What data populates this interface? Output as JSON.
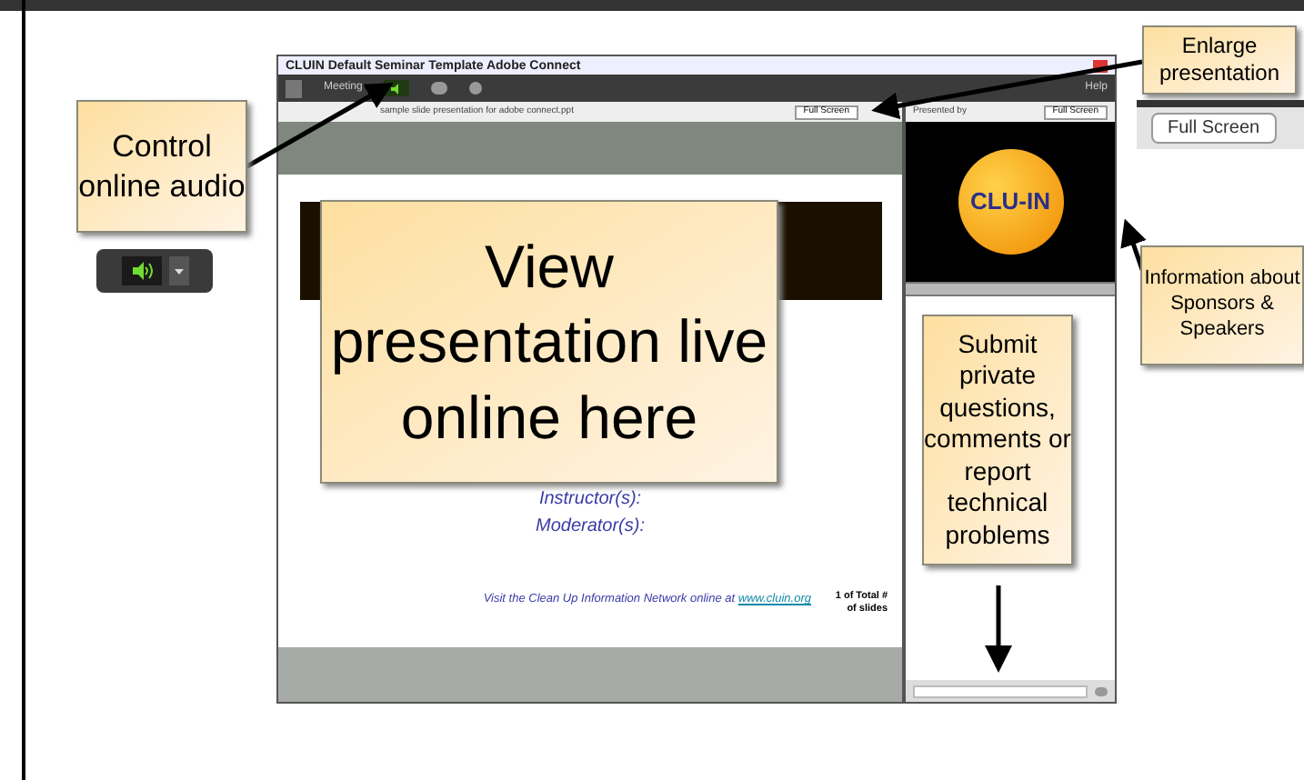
{
  "window": {
    "title": "CLUIN Default Seminar Template  Adobe Connect",
    "menu": [
      "Meeting",
      "Help"
    ]
  },
  "presentation": {
    "file_name": "sample slide presentation for adobe connect.ppt",
    "full_screen": "Full Screen",
    "instructors": "Instructor(s):",
    "moderators": "Moderator(s):",
    "footer": "Visit the Clean Up Information Network online at",
    "link": "www.cluin.org",
    "page": "1 of Total # of slides"
  },
  "sponsor_pod": {
    "title": "Presented by",
    "full_screen": "Full Screen",
    "logo": "CLU-IN"
  },
  "callouts": [
    {
      "kind": "audio",
      "text": "Control online audio"
    },
    {
      "kind": "enlarge",
      "text": "Enlarge presentation",
      "button": "Full Screen"
    },
    {
      "kind": "info",
      "text": "Information about Sponsors & Speakers"
    },
    {
      "kind": "view",
      "text": "View presentation live online here"
    },
    {
      "kind": "submit",
      "text": "Submit private questions, comments or report technical problems"
    }
  ]
}
